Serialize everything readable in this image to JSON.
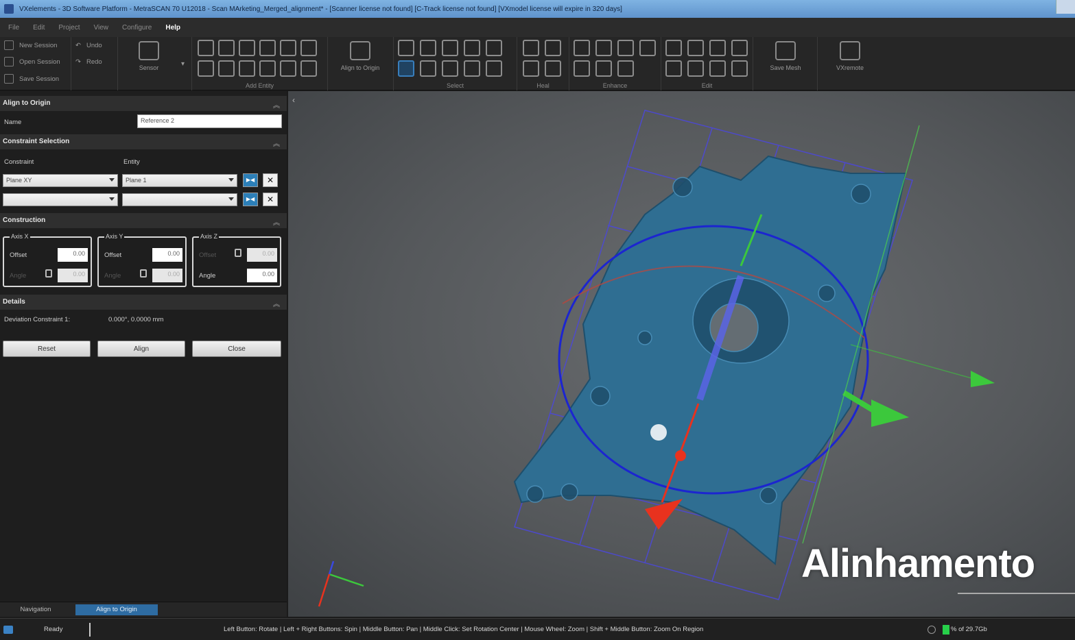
{
  "window": {
    "title": "VXelements - 3D Software Platform - MetraSCAN 70 U12018 - Scan MArketing_Merged_alignment* - [Scanner license not found] [C-Track license not found] [VXmodel license will expire in 320 days]"
  },
  "menu": {
    "items": [
      {
        "label": "File",
        "active": false
      },
      {
        "label": "Edit",
        "active": false
      },
      {
        "label": "Project",
        "active": false
      },
      {
        "label": "View",
        "active": false
      },
      {
        "label": "Configure",
        "active": false
      },
      {
        "label": "Help",
        "active": true
      }
    ]
  },
  "ribbon": {
    "session": {
      "new": "New Session",
      "open": "Open Session",
      "save": "Save Session"
    },
    "history": {
      "undo": "Undo",
      "redo": "Redo"
    },
    "sensor_label": "Sensor",
    "add_entity_label": "Add Entity",
    "align_origin_label": "Align to Origin",
    "select_label": "Select",
    "heal_label": "Heal",
    "enhance_label": "Enhance",
    "edit_label": "Edit",
    "save_mesh_label": "Save Mesh",
    "vxremote_label": "VXremote"
  },
  "panel": {
    "align_section": {
      "title": "Align to Origin",
      "name_label": "Name",
      "name_value": "Reference 2"
    },
    "constraint_section": {
      "title": "Constraint Selection",
      "constraint_header": "Constraint",
      "entity_header": "Entity",
      "rows": [
        {
          "constraint": "Plane XY",
          "entity": "Plane 1"
        },
        {
          "constraint": "",
          "entity": ""
        }
      ]
    },
    "construction_section": {
      "title": "Construction",
      "axis_x": {
        "legend": "Axis X",
        "offset_label": "Offset",
        "offset": "0.00",
        "angle_label": "Angle",
        "angle": "0.00"
      },
      "axis_y": {
        "legend": "Axis Y",
        "offset_label": "Offset",
        "offset": "0.00",
        "angle_label": "Angle",
        "angle": "0.00"
      },
      "axis_z": {
        "legend": "Axis Z",
        "offset_label": "Offset",
        "offset": "0.00",
        "angle_label": "Angle",
        "angle": "0.00"
      }
    },
    "details_section": {
      "title": "Details",
      "deviation_label": "Deviation Constraint 1:",
      "deviation_value": "0.000°, 0.0000 mm"
    },
    "buttons": {
      "reset": "Reset",
      "align": "Align",
      "close": "Close"
    },
    "tabs": [
      {
        "label": "Navigation",
        "active": false
      },
      {
        "label": "Align to Origin",
        "active": true
      }
    ]
  },
  "viewport": {
    "overlay_caption": "Alinhamento"
  },
  "status": {
    "state": "Ready",
    "hints": "Left Button: Rotate  |  Left + Right Buttons: Spin  |  Middle Button: Pan  |  Middle Click: Set Rotation Center  |  Mouse Wheel: Zoom  |  Shift + Middle Button: Zoom On Region",
    "memory": "% of 29.7Gb"
  },
  "colors": {
    "accent": "#2e6ca2",
    "part": "#2f6e92",
    "axis_x": "#e8321e",
    "axis_y": "#3cc83c",
    "axis_z": "#4a5be0"
  }
}
